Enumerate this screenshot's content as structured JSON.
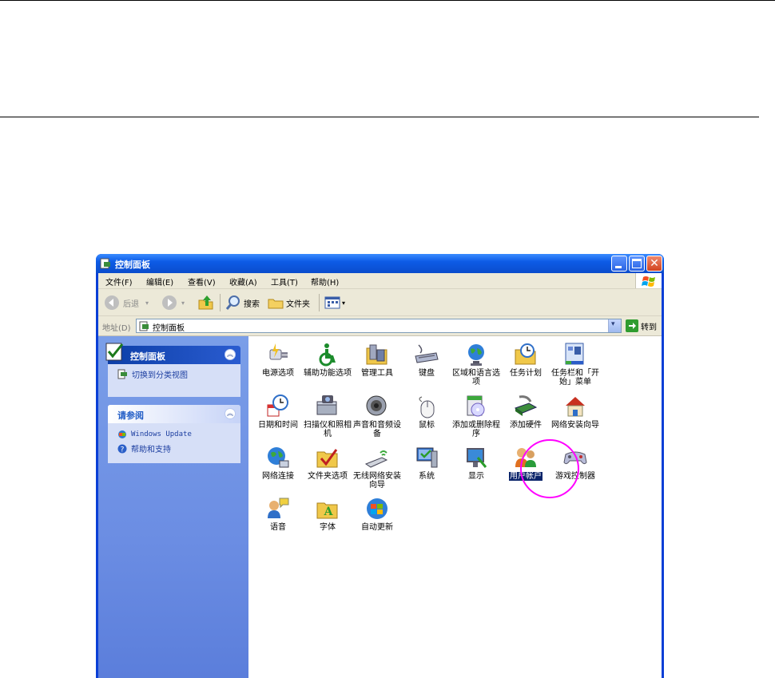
{
  "window": {
    "title": "控制面板"
  },
  "menu": [
    "文件(F)",
    "编辑(E)",
    "查看(V)",
    "收藏(A)",
    "工具(T)",
    "帮助(H)"
  ],
  "toolbar": {
    "back": "后退",
    "search": "搜索",
    "folders": "文件夹"
  },
  "address": {
    "label": "地址(D)",
    "value": "控制面板",
    "go": "转到"
  },
  "sidebar": {
    "panel1": {
      "title": "控制面板",
      "link": "切换到分类视图"
    },
    "panel2": {
      "title": "请参阅",
      "links": [
        "Windows Update",
        "帮助和支持"
      ]
    }
  },
  "icons": [
    {
      "label": "电源选项",
      "icon": "power-options-icon"
    },
    {
      "label": "辅助功能选项",
      "icon": "accessibility-icon"
    },
    {
      "label": "管理工具",
      "icon": "admin-tools-icon"
    },
    {
      "label": "键盘",
      "icon": "keyboard-icon"
    },
    {
      "label": "区域和语言选项",
      "icon": "globe-icon"
    },
    {
      "label": "任务计划",
      "icon": "scheduled-tasks-icon"
    },
    {
      "label": "任务栏和「开始」菜单",
      "icon": "taskbar-icon"
    },
    {
      "label": "日期和时间",
      "icon": "clock-icon"
    },
    {
      "label": "扫描仪和照相机",
      "icon": "scanner-icon"
    },
    {
      "label": "声音和音频设备",
      "icon": "speaker-icon"
    },
    {
      "label": "鼠标",
      "icon": "mouse-icon"
    },
    {
      "label": "添加或删除程序",
      "icon": "add-remove-icon"
    },
    {
      "label": "添加硬件",
      "icon": "hardware-icon"
    },
    {
      "label": "网络安装向导",
      "icon": "home-network-icon"
    },
    {
      "label": "网络连接",
      "icon": "network-icon"
    },
    {
      "label": "文件夹选项",
      "icon": "folder-options-icon"
    },
    {
      "label": "无线网络安装向导",
      "icon": "wireless-icon"
    },
    {
      "label": "系统",
      "icon": "system-icon"
    },
    {
      "label": "显示",
      "icon": "display-icon"
    },
    {
      "label": "用户帐户",
      "icon": "user-accounts-icon",
      "selected": true
    },
    {
      "label": "游戏控制器",
      "icon": "gamepad-icon"
    },
    {
      "label": "语音",
      "icon": "speech-icon"
    },
    {
      "label": "字体",
      "icon": "fonts-icon"
    },
    {
      "label": "自动更新",
      "icon": "windows-update-icon"
    }
  ]
}
